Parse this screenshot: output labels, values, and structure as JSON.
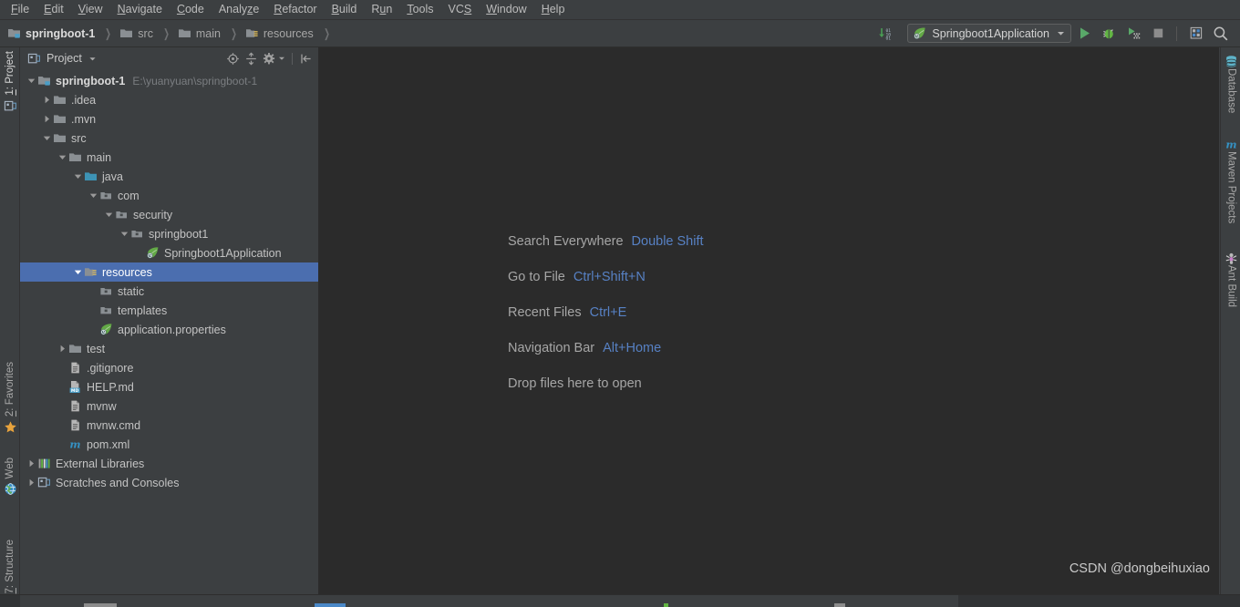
{
  "window": {
    "accent_blue": "#5781c4",
    "selection_blue": "#4b6eaf",
    "panel_bg": "#3c3f41",
    "editor_bg": "#2b2b2b"
  },
  "menubar": {
    "items": [
      {
        "label": "File",
        "mnemonic": "F"
      },
      {
        "label": "Edit",
        "mnemonic": "E"
      },
      {
        "label": "View",
        "mnemonic": "V"
      },
      {
        "label": "Navigate",
        "mnemonic": "N"
      },
      {
        "label": "Code",
        "mnemonic": "C"
      },
      {
        "label": "Analyze",
        "mnemonic": "z"
      },
      {
        "label": "Refactor",
        "mnemonic": "R"
      },
      {
        "label": "Build",
        "mnemonic": "B"
      },
      {
        "label": "Run",
        "mnemonic": "u"
      },
      {
        "label": "Tools",
        "mnemonic": "T"
      },
      {
        "label": "VCS",
        "mnemonic": "S"
      },
      {
        "label": "Window",
        "mnemonic": "W"
      },
      {
        "label": "Help",
        "mnemonic": "H"
      }
    ]
  },
  "toolbar": {
    "breadcrumbs": [
      {
        "label": "springboot-1",
        "icon": "module-icon"
      },
      {
        "label": "src",
        "icon": "folder-icon"
      },
      {
        "label": "main",
        "icon": "folder-icon"
      },
      {
        "label": "resources",
        "icon": "resources-folder-icon"
      }
    ],
    "separator": "❯",
    "run_config": {
      "label": "Springboot1Application",
      "icon": "spring-leaf-icon",
      "dropdown": "▼"
    },
    "buttons": [
      {
        "name": "update-running-application-button",
        "icon": "update-icon"
      },
      {
        "name": "run-button",
        "icon": "run-triangle-icon"
      },
      {
        "name": "debug-button",
        "icon": "debug-bug-icon"
      },
      {
        "name": "run-with-coverage-button",
        "icon": "coverage-icon"
      },
      {
        "name": "stop-button",
        "icon": "stop-square-icon"
      },
      {
        "name": "toggle-layout-button",
        "icon": "layout-icon"
      },
      {
        "name": "search-button",
        "icon": "search-icon"
      }
    ]
  },
  "left_stripe": {
    "tabs": [
      {
        "label": "1: Project",
        "mnemonic": "1",
        "icon": "project-icon",
        "active": true
      },
      {
        "label": "2: Favorites",
        "mnemonic": "2",
        "icon": "star-icon",
        "active": false
      },
      {
        "label": "Web",
        "mnemonic": "",
        "icon": "web-globe-icon",
        "active": false
      },
      {
        "label": "7: Structure",
        "mnemonic": "7",
        "icon": "structure-icon",
        "active": false
      }
    ]
  },
  "right_stripe": {
    "tabs": [
      {
        "label": "Database",
        "icon": "database-icon"
      },
      {
        "label": "Maven Projects",
        "icon": "maven-m-icon"
      },
      {
        "label": "Ant Build",
        "icon": "ant-icon"
      }
    ]
  },
  "project_panel": {
    "title": "Project",
    "title_dropdown": "▾",
    "title_icon": "project-icon",
    "tools": [
      {
        "name": "select-opened-file-button",
        "icon": "locate-target-icon"
      },
      {
        "name": "collapse-all-button",
        "icon": "collapse-all-icon"
      },
      {
        "name": "settings-button",
        "icon": "gear-icon"
      },
      {
        "name": "hide-panel-button",
        "icon": "hide-panel-icon"
      }
    ],
    "tree": [
      {
        "label": "springboot-1",
        "sublabel": "E:\\yuanyuan\\springboot-1",
        "indent": 0,
        "arrow": "down",
        "icon": "module-icon",
        "bold": true,
        "selected": false
      },
      {
        "label": ".idea",
        "sublabel": "",
        "indent": 1,
        "arrow": "right",
        "icon": "folder-icon",
        "bold": false,
        "selected": false
      },
      {
        "label": ".mvn",
        "sublabel": "",
        "indent": 1,
        "arrow": "right",
        "icon": "folder-icon",
        "bold": false,
        "selected": false
      },
      {
        "label": "src",
        "sublabel": "",
        "indent": 1,
        "arrow": "down",
        "icon": "folder-icon",
        "bold": false,
        "selected": false
      },
      {
        "label": "main",
        "sublabel": "",
        "indent": 2,
        "arrow": "down",
        "icon": "folder-icon",
        "bold": false,
        "selected": false
      },
      {
        "label": "java",
        "sublabel": "",
        "indent": 3,
        "arrow": "down",
        "icon": "source-root-icon",
        "bold": false,
        "selected": false
      },
      {
        "label": "com",
        "sublabel": "",
        "indent": 4,
        "arrow": "down",
        "icon": "package-icon",
        "bold": false,
        "selected": false
      },
      {
        "label": "security",
        "sublabel": "",
        "indent": 5,
        "arrow": "down",
        "icon": "package-icon",
        "bold": false,
        "selected": false
      },
      {
        "label": "springboot1",
        "sublabel": "",
        "indent": 6,
        "arrow": "down",
        "icon": "package-icon",
        "bold": false,
        "selected": false
      },
      {
        "label": "Springboot1Application",
        "sublabel": "",
        "indent": 7,
        "arrow": "none",
        "icon": "spring-class-icon",
        "bold": false,
        "selected": false
      },
      {
        "label": "resources",
        "sublabel": "",
        "indent": 3,
        "arrow": "down",
        "icon": "resources-folder-icon",
        "bold": false,
        "selected": true
      },
      {
        "label": "static",
        "sublabel": "",
        "indent": 4,
        "arrow": "none",
        "icon": "package-icon",
        "bold": false,
        "selected": false
      },
      {
        "label": "templates",
        "sublabel": "",
        "indent": 4,
        "arrow": "none",
        "icon": "package-icon",
        "bold": false,
        "selected": false
      },
      {
        "label": "application.properties",
        "sublabel": "",
        "indent": 4,
        "arrow": "none",
        "icon": "spring-properties-icon",
        "bold": false,
        "selected": false
      },
      {
        "label": "test",
        "sublabel": "",
        "indent": 2,
        "arrow": "right",
        "icon": "folder-icon",
        "bold": false,
        "selected": false
      },
      {
        "label": ".gitignore",
        "sublabel": "",
        "indent": 2,
        "arrow": "none",
        "icon": "file-icon",
        "bold": false,
        "selected": false
      },
      {
        "label": "HELP.md",
        "sublabel": "",
        "indent": 2,
        "arrow": "none",
        "icon": "markdown-file-icon",
        "bold": false,
        "selected": false
      },
      {
        "label": "mvnw",
        "sublabel": "",
        "indent": 2,
        "arrow": "none",
        "icon": "file-icon",
        "bold": false,
        "selected": false
      },
      {
        "label": "mvnw.cmd",
        "sublabel": "",
        "indent": 2,
        "arrow": "none",
        "icon": "file-icon",
        "bold": false,
        "selected": false
      },
      {
        "label": "pom.xml",
        "sublabel": "",
        "indent": 2,
        "arrow": "none",
        "icon": "maven-m-icon",
        "bold": false,
        "selected": false
      },
      {
        "label": "External Libraries",
        "sublabel": "",
        "indent": 0,
        "arrow": "right",
        "icon": "libraries-icon",
        "bold": false,
        "selected": false
      },
      {
        "label": "Scratches and Consoles",
        "sublabel": "",
        "indent": 0,
        "arrow": "right",
        "icon": "scratches-icon",
        "bold": false,
        "selected": false
      }
    ]
  },
  "editor": {
    "hints": [
      {
        "name": "Search Everywhere",
        "key": "Double Shift"
      },
      {
        "name": "Go to File",
        "key": "Ctrl+Shift+N"
      },
      {
        "name": "Recent Files",
        "key": "Ctrl+E"
      },
      {
        "name": "Navigation Bar",
        "key": "Alt+Home"
      },
      {
        "name": "Drop files here to open",
        "key": ""
      }
    ],
    "watermark": "CSDN @dongbeihuxiao"
  }
}
